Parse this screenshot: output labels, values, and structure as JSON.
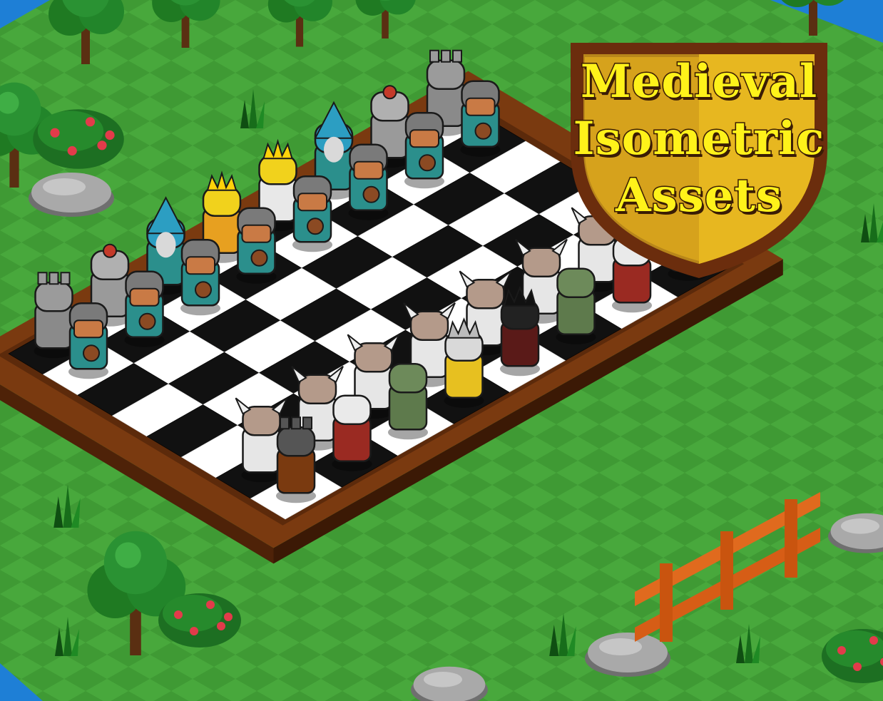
{
  "title": {
    "lines": [
      "Medieval",
      "Isometric",
      "Assets"
    ]
  },
  "board": {
    "ranks": 8,
    "files": 8
  },
  "pieces": {
    "knights_team": {
      "back": [
        "rook",
        "knight",
        "wizard",
        "king",
        "queen",
        "wizard",
        "knight",
        "rook"
      ],
      "pawns": 8
    },
    "vikings_team": {
      "back": [
        "tower",
        "skeleton",
        "orc",
        "undead-king",
        "undead-queen",
        "orc",
        "skeleton",
        "tower"
      ],
      "pawns": 8
    }
  },
  "colors": {
    "grass": "#3f9a34",
    "grass_light": "#4caf3f",
    "board_frame": "#7a3a10",
    "square_light": "#ffffff",
    "square_dark": "#111111",
    "title_text": "#fff21a",
    "shield_gold": "#e7b720",
    "shield_rim": "#6b2d0d",
    "water": "#1e7fd6"
  },
  "icons": [
    "tree-icon",
    "bush-icon",
    "rock-icon",
    "grass-tuft-icon",
    "fence-icon",
    "shield-icon"
  ]
}
